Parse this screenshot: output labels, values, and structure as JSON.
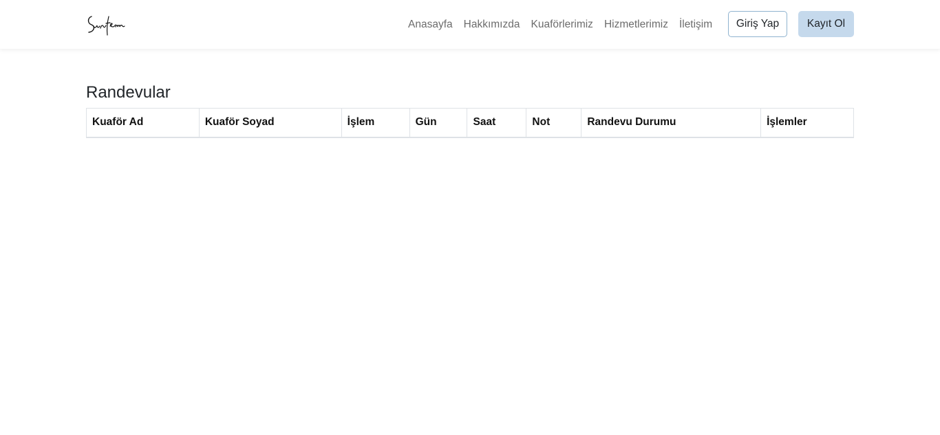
{
  "navbar": {
    "brand": "Sunfem",
    "links": [
      "Anasayfa",
      "Hakkımızda",
      "Kuaförlerimiz",
      "Hizmetlerimiz",
      "İletişim"
    ],
    "login_label": "Giriş Yap",
    "register_label": "Kayıt Ol"
  },
  "page": {
    "title": "Randevular"
  },
  "table": {
    "headers": [
      "Kuaför Ad",
      "Kuaför Soyad",
      "İşlem",
      "Gün",
      "Saat",
      "Not",
      "Randevu Durumu",
      "İşlemler"
    ],
    "rows": []
  },
  "colors": {
    "login_border": "#8fb3cf",
    "register_bg": "#c5d9ec",
    "nav_link": "#6c6c6c"
  }
}
